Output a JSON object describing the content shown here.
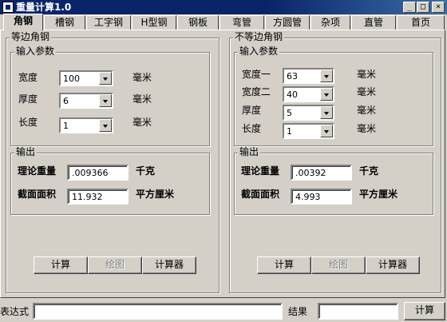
{
  "window": {
    "title": "重量计算1.0",
    "min_label": "_",
    "max_label": "□",
    "close_label": "×"
  },
  "tabs": [
    {
      "label": "角钢",
      "active": true
    },
    {
      "label": "槽钢"
    },
    {
      "label": "工字钢"
    },
    {
      "label": "H型钢"
    },
    {
      "label": "钢板"
    },
    {
      "label": "弯管"
    },
    {
      "label": "方圆管"
    },
    {
      "label": "杂项"
    },
    {
      "label": "直管"
    },
    {
      "label": "首页"
    }
  ],
  "equal_angle": {
    "group_title": "等边角钢",
    "input_group_title": "输入参数",
    "width_label": "宽度",
    "width_value": "100",
    "width_unit": "毫米",
    "thickness_label": "厚度",
    "thickness_value": "6",
    "thickness_unit": "毫米",
    "length_label": "长度",
    "length_value": "1",
    "length_unit": "毫米",
    "output_group_title": "输出",
    "weight_label": "理论重量",
    "weight_value": ".009366",
    "weight_unit": "千克",
    "area_label": "截面面积",
    "area_value": "11.932",
    "area_unit": "平方厘米",
    "calc_label": "计算",
    "draw_label": "绘图",
    "calculator_label": "计算器"
  },
  "unequal_angle": {
    "group_title": "不等边角钢",
    "input_group_title": "输入参数",
    "width1_label": "宽度一",
    "width1_value": "63",
    "width1_unit": "毫米",
    "width2_label": "宽度二",
    "width2_value": "40",
    "width2_unit": "毫米",
    "thickness_label": "厚度",
    "thickness_value": "5",
    "thickness_unit": "毫米",
    "length_label": "长度",
    "length_value": "1",
    "length_unit": "毫米",
    "output_group_title": "输出",
    "weight_label": "理论重量",
    "weight_value": ".00392",
    "weight_unit": "千克",
    "area_label": "截面面积",
    "area_value": "4.993",
    "area_unit": "平方厘米",
    "calc_label": "计算",
    "draw_label": "绘图",
    "calculator_label": "计算器"
  },
  "bottom": {
    "expression_label": "表达式",
    "expression_value": "",
    "result_label": "结果",
    "result_value": "",
    "calc_label": "计算"
  }
}
